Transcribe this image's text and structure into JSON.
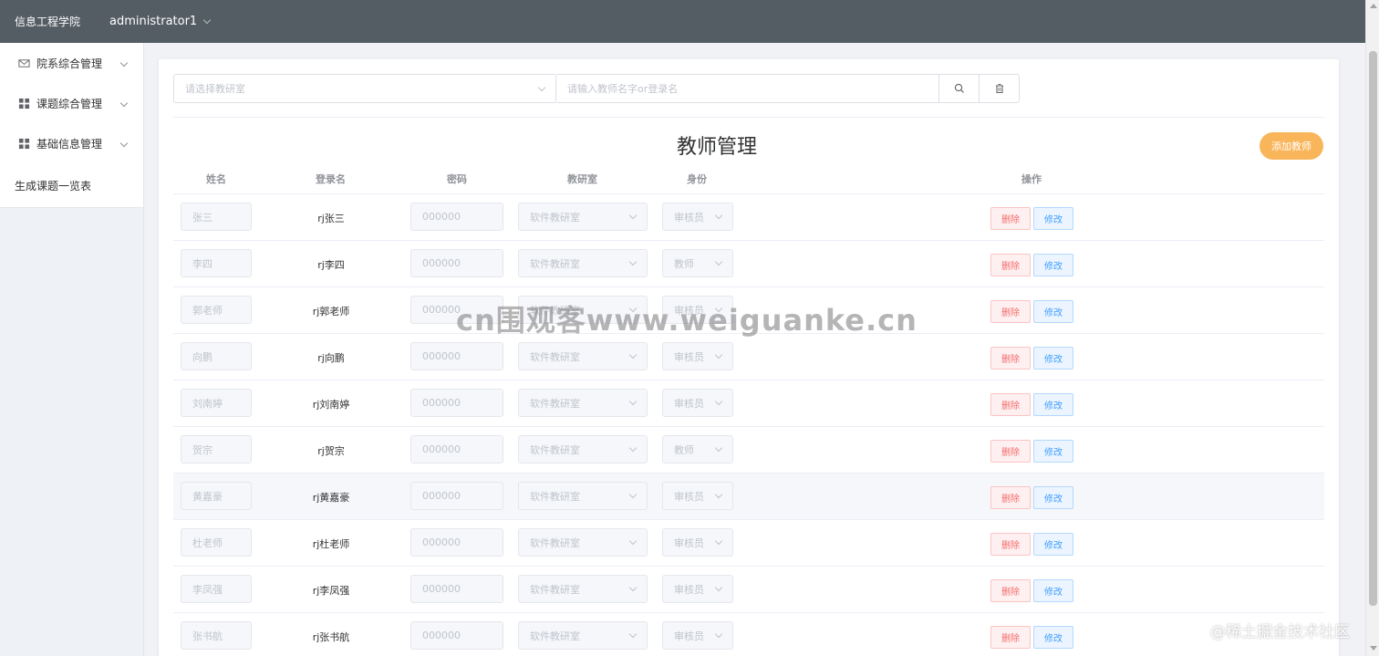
{
  "header": {
    "brand": "信息工程学院",
    "user": "administrator1"
  },
  "sidebar": {
    "items": [
      {
        "label": "院系综合管理",
        "icon": "mail-icon"
      },
      {
        "label": "课题综合管理",
        "icon": "grid-icon"
      },
      {
        "label": "基础信息管理",
        "icon": "grid-icon"
      }
    ],
    "plain_item": "生成课题一览表"
  },
  "toolbar": {
    "select_placeholder": "请选择教研室",
    "search_placeholder": "请输入教师名字or登录名"
  },
  "page": {
    "title": "教师管理",
    "add_label": "添加教师"
  },
  "table": {
    "headers": {
      "name": "姓名",
      "login": "登录名",
      "password": "密码",
      "office": "教研室",
      "role": "身份",
      "ops": "操作"
    },
    "delete_label": "删除",
    "edit_label": "修改",
    "rows": [
      {
        "name": "张三",
        "login": "rj张三",
        "password": "000000",
        "office": "软件教研室",
        "role": "审核员"
      },
      {
        "name": "李四",
        "login": "rj李四",
        "password": "000000",
        "office": "软件教研室",
        "role": "教师"
      },
      {
        "name": "郭老师",
        "login": "rj郭老师",
        "password": "000000",
        "office": "软件教研室",
        "role": "审核员"
      },
      {
        "name": "向鹏",
        "login": "rj向鹏",
        "password": "000000",
        "office": "软件教研室",
        "role": "审核员"
      },
      {
        "name": "刘南婷",
        "login": "rj刘南婷",
        "password": "000000",
        "office": "软件教研室",
        "role": "审核员"
      },
      {
        "name": "贺宗",
        "login": "rj贺宗",
        "password": "000000",
        "office": "软件教研室",
        "role": "教师"
      },
      {
        "name": "黄嘉豪",
        "login": "rj黄嘉豪",
        "password": "000000",
        "office": "软件教研室",
        "role": "审核员"
      },
      {
        "name": "杜老师",
        "login": "rj杜老师",
        "password": "000000",
        "office": "软件教研室",
        "role": "审核员"
      },
      {
        "name": "李凤强",
        "login": "rj李凤强",
        "password": "000000",
        "office": "软件教研室",
        "role": "审核员"
      },
      {
        "name": "张书航",
        "login": "rj张书航",
        "password": "000000",
        "office": "软件教研室",
        "role": "审核员"
      }
    ]
  },
  "overlay": {
    "watermark": "cn围观客www.weiguanke.cn",
    "corner": "@稀土掘金技术社区"
  },
  "colors": {
    "header_bg": "#545c64",
    "add_button": "#f9b55a",
    "danger": "#f56c6c",
    "primary": "#409eff"
  }
}
